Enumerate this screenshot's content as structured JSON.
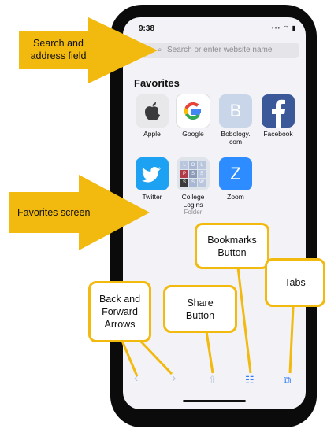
{
  "status_bar": {
    "time": "9:38",
    "icons": "••• ◠ ▮"
  },
  "search": {
    "placeholder": "Search or enter website name"
  },
  "favorites": {
    "title": "Favorites",
    "items": [
      {
        "label": "Apple",
        "sub": ""
      },
      {
        "label": "Google",
        "sub": ""
      },
      {
        "label": "Bobology.\ncom",
        "sub": "",
        "glyph": "B"
      },
      {
        "label": "Facebook",
        "sub": ""
      },
      {
        "label": "Twitter",
        "sub": ""
      },
      {
        "label": "College\nLogins",
        "sub": "Folder"
      },
      {
        "label": "Zoom",
        "sub": "",
        "glyph": "Z"
      }
    ]
  },
  "folder_grid": [
    "L",
    "O",
    "L",
    "P",
    "S",
    "S",
    "S",
    "S",
    "W"
  ],
  "toolbar": {
    "back": "‹",
    "forward": "›",
    "share": "⇧",
    "bookmarks": "☷",
    "tabs": "⧉"
  },
  "annotations": {
    "search_field": "Search and\naddress field",
    "favorites_screen": "Favorites screen",
    "back_forward": "Back and\nForward\nArrows",
    "share": "Share\nButton",
    "bookmarks": "Bookmarks\nButton",
    "tabs": "Tabs"
  },
  "colors": {
    "accent": "#f2b90f",
    "link": "#2f7cf6",
    "facebook": "#3b5998",
    "twitter": "#1da1f2",
    "zoom": "#2d8cff",
    "bobology": "#c9d6ea"
  }
}
